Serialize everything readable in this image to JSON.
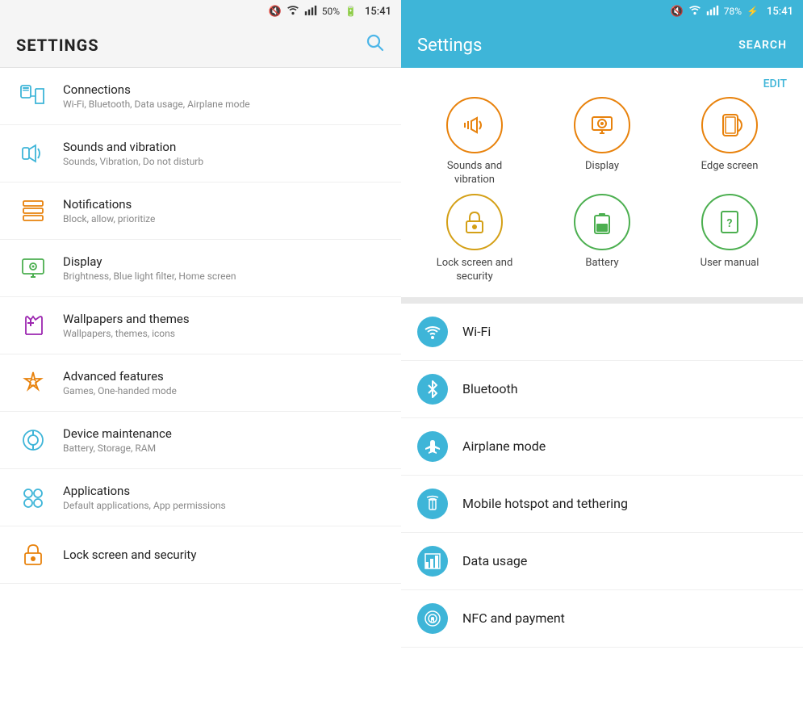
{
  "left": {
    "status_bar": {
      "mute": "🔇",
      "wifi": "WiFi",
      "signal": "▌▌▌",
      "battery": "50%",
      "time": "15:41"
    },
    "header": {
      "title": "SETTINGS",
      "search_label": "🔍"
    },
    "items": [
      {
        "id": "connections",
        "title": "Connections",
        "subtitle": "Wi-Fi, Bluetooth, Data usage, Airplane mode",
        "icon_color": "#3eb5d8",
        "icon_type": "connections"
      },
      {
        "id": "sounds",
        "title": "Sounds and vibration",
        "subtitle": "Sounds, Vibration, Do not disturb",
        "icon_color": "#3eb5d8",
        "icon_type": "sound"
      },
      {
        "id": "notifications",
        "title": "Notifications",
        "subtitle": "Block, allow, prioritize",
        "icon_color": "#e8820c",
        "icon_type": "notifications"
      },
      {
        "id": "display",
        "title": "Display",
        "subtitle": "Brightness, Blue light filter, Home screen",
        "icon_color": "#4caf50",
        "icon_type": "display"
      },
      {
        "id": "wallpapers",
        "title": "Wallpapers and themes",
        "subtitle": "Wallpapers, themes, icons",
        "icon_color": "#9c27b0",
        "icon_type": "wallpaper"
      },
      {
        "id": "advanced",
        "title": "Advanced features",
        "subtitle": "Games, One-handed mode",
        "icon_color": "#e8820c",
        "icon_type": "advanced"
      },
      {
        "id": "device",
        "title": "Device maintenance",
        "subtitle": "Battery, Storage, RAM",
        "icon_color": "#3eb5d8",
        "icon_type": "device"
      },
      {
        "id": "applications",
        "title": "Applications",
        "subtitle": "Default applications, App permissions",
        "icon_color": "#3eb5d8",
        "icon_type": "apps"
      },
      {
        "id": "lockscreen",
        "title": "Lock screen and security",
        "subtitle": "",
        "icon_color": "#e8820c",
        "icon_type": "lock"
      }
    ]
  },
  "right": {
    "status_bar": {
      "mute": "🔇",
      "wifi": "WiFi",
      "signal": "▌▌▌",
      "battery": "78%",
      "time": "15:41"
    },
    "header": {
      "title": "Settings",
      "search_label": "SEARCH"
    },
    "edit_label": "EDIT",
    "favorites": [
      {
        "id": "sounds-vib",
        "label": "Sounds and\nvibration",
        "icon": "🔊",
        "color_class": "color-orange"
      },
      {
        "id": "display",
        "label": "Display",
        "icon": "⚙",
        "color_class": "color-orange"
      },
      {
        "id": "edge-screen",
        "label": "Edge screen",
        "icon": "▭",
        "color_class": "color-orange"
      },
      {
        "id": "lock-screen",
        "label": "Lock screen and\nsecurity",
        "icon": "🔒",
        "color_class": "color-gold"
      },
      {
        "id": "battery",
        "label": "Battery",
        "icon": "🔋",
        "color_class": "color-green"
      },
      {
        "id": "user-manual",
        "label": "User manual",
        "icon": "?",
        "color_class": "color-green"
      }
    ],
    "list_items": [
      {
        "id": "wifi",
        "title": "Wi-Fi",
        "icon": "wifi"
      },
      {
        "id": "bluetooth",
        "title": "Bluetooth",
        "icon": "bt"
      },
      {
        "id": "airplane",
        "title": "Airplane mode",
        "icon": "plane"
      },
      {
        "id": "hotspot",
        "title": "Mobile hotspot and tethering",
        "icon": "hotspot"
      },
      {
        "id": "data-usage",
        "title": "Data usage",
        "icon": "data"
      },
      {
        "id": "nfc",
        "title": "NFC and payment",
        "icon": "nfc"
      }
    ]
  }
}
